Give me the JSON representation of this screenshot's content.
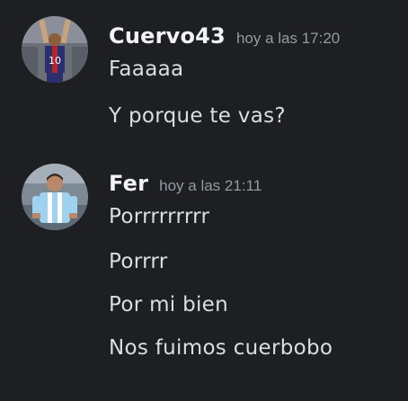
{
  "chat": {
    "groups": [
      {
        "author": "Cuervo43",
        "timestamp": "hoy a las 17:20",
        "avatar_icon": "avatar-soccer-player-red-blue-jersey",
        "messages": [
          "Faaaaa",
          "Y porque te vas?"
        ]
      },
      {
        "author": "Fer",
        "timestamp": "hoy a las 21:11",
        "avatar_icon": "avatar-soccer-player-sky-blue-jersey",
        "messages": [
          "Porrrrrrrrr",
          "Porrrr",
          "Por mi bien",
          "Nos fuimos cuerbobo"
        ]
      }
    ]
  },
  "colors": {
    "background": "#1e1f22",
    "username": "#f2f3f5",
    "timestamp": "#949ba4",
    "message_text": "#dbdee1"
  }
}
